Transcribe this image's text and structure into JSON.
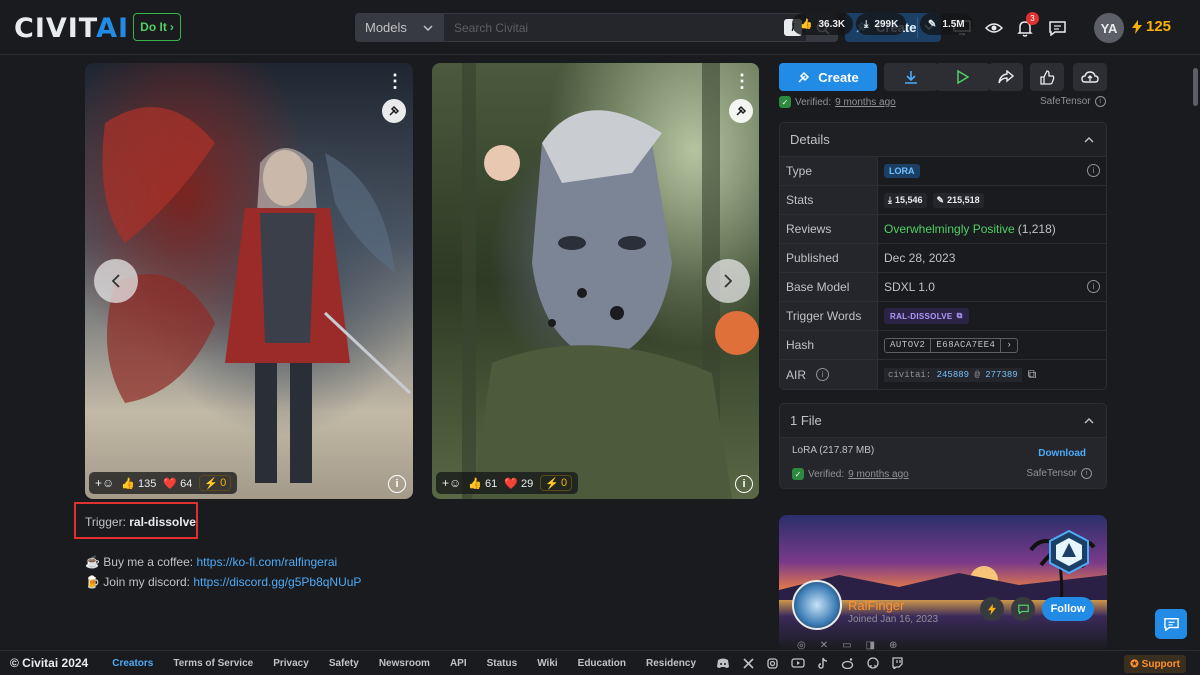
{
  "header": {
    "logo_main": "CIVIT",
    "logo_accent": "AI",
    "doit_label": "Do It",
    "models_select": "Models",
    "search_placeholder": "Search Civitai",
    "slash_key": "/",
    "create_label": "Create",
    "notification_count": "3",
    "avatar_initials": "YA",
    "buzz_amount": "125"
  },
  "gallery": {
    "card1": {
      "likes": "135",
      "hearts": "64",
      "buzz": "0"
    },
    "card2": {
      "likes": "61",
      "hearts": "29",
      "buzz": "0"
    }
  },
  "description": {
    "trigger_label": "Trigger:",
    "trigger_word": "ral-dissolve",
    "coffee_prefix": "Buy me a coffee:",
    "coffee_link": "https://ko-fi.com/ralfingerai",
    "discord_prefix": "Join my discord:",
    "discord_link": "https://discord.gg/g5Pb8qNUuP"
  },
  "actions": {
    "create_label": "Create",
    "verified_prefix": "Verified:",
    "verified_time": "9 months ago",
    "safetensor": "SafeTensor"
  },
  "details": {
    "title": "Details",
    "rows": {
      "type_label": "Type",
      "type_value": "LORA",
      "stats_label": "Stats",
      "downloads": "15,546",
      "generations": "215,518",
      "reviews_label": "Reviews",
      "reviews_value": "Overwhelmingly Positive",
      "reviews_count": "(1,218)",
      "published_label": "Published",
      "published_value": "Dec 28, 2023",
      "base_label": "Base Model",
      "base_value": "SDXL 1.0",
      "trigger_label": "Trigger Words",
      "trigger_value": "RAL-DISSOLVE",
      "hash_label": "Hash",
      "hash_type": "AUTOV2",
      "hash_value": "E68ACA7EE4",
      "air_label": "AIR",
      "air_prefix": "civitai:",
      "air_model": "245889",
      "air_at": "@",
      "air_version": "277389"
    }
  },
  "files": {
    "title": "1 File",
    "file_name": "LoRA (217.87 MB)",
    "download_label": "Download",
    "verified_prefix": "Verified:",
    "verified_time": "9 months ago",
    "safetensor": "SafeTensor"
  },
  "creator": {
    "likes": "36.3K",
    "downloads": "299K",
    "generations": "1.5M",
    "name": "RalFinger",
    "joined": "Joined Jan 16, 2023",
    "follow_label": "Follow"
  },
  "footer": {
    "copyright": "© Civitai 2024",
    "links": [
      "Creators",
      "Terms of Service",
      "Privacy",
      "Safety",
      "Newsroom",
      "API",
      "Status",
      "Wiki",
      "Education",
      "Residency"
    ],
    "support_label": "Support"
  },
  "colors": {
    "accent": "#228be6",
    "highlight_box": "#e03131",
    "positive": "#51cf66",
    "buzz": "#fab005"
  }
}
